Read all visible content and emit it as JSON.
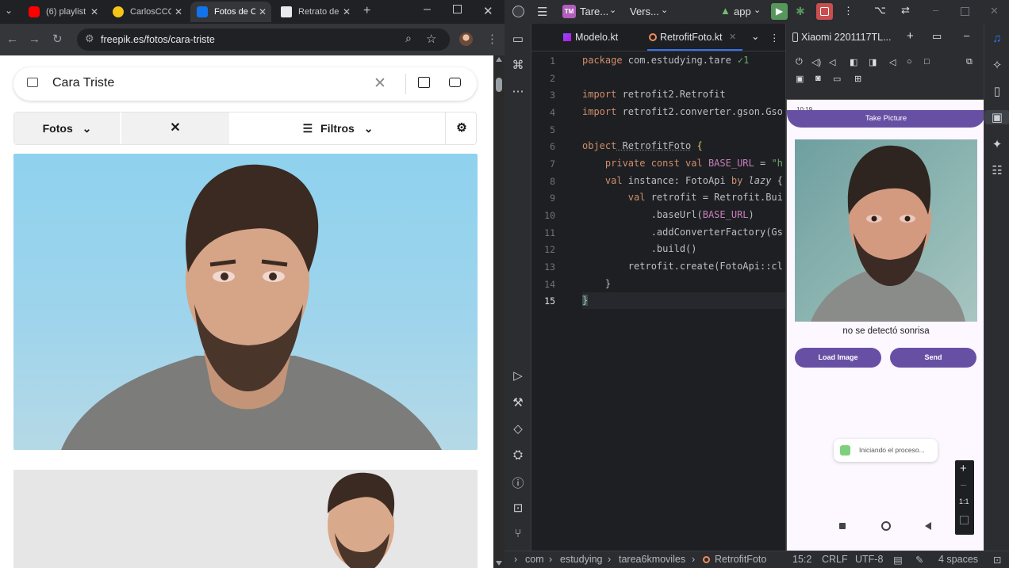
{
  "browser": {
    "tabs": [
      {
        "label": "(6) playlist",
        "favicon_color": "#ff0000"
      },
      {
        "label": "CarlosCCC",
        "favicon_color": "#f5c518"
      },
      {
        "label": "Fotos de C",
        "favicon_color": "#1273eb"
      },
      {
        "label": "Retrato de",
        "favicon_color": "#e8eaed"
      }
    ],
    "url": "freepik.es/fotos/cara-triste",
    "search": {
      "query": "Cara Triste"
    },
    "filters": {
      "photos_label": "Fotos",
      "filters_label": "Filtros"
    }
  },
  "ide": {
    "project": "Tare...",
    "project_badge": "TM",
    "vcs": "Vers...",
    "run_config": "app",
    "tabs": [
      {
        "label": "Modelo.kt"
      },
      {
        "label": "RetrofitFoto.kt"
      }
    ],
    "inspection": "1",
    "device": "Xiaomi 2201117TL...",
    "line_numbers": [
      "1",
      "2",
      "3",
      "4",
      "5",
      "6",
      "7",
      "8",
      "9",
      "10",
      "11",
      "12",
      "13",
      "14",
      "15"
    ],
    "code": {
      "l1_kw": "package",
      "l1_rest": " com.estudying.tare",
      "l3_kw": "import",
      "l3_rest": " retrofit2.Retrofit",
      "l4_kw": "import",
      "l4_rest": " retrofit2.converter.gson.Gso",
      "l6_kw": "object",
      "l6_name": " RetrofitFoto",
      "l6_brace": " {",
      "l7_kw": "    private const val",
      "l7_name": " BASE_URL",
      "l7_eq": " = ",
      "l7_str": "\"h",
      "l8_kw": "    val",
      "l8_rest": " instance: FotoApi ",
      "l8_by": "by",
      "l8_lazy": " lazy",
      "l8_brace": " {",
      "l9_kw": "        val",
      "l9_rest": " retrofit = Retrofit.Bui",
      "l10": "            .baseUrl(",
      "l10_c": "BASE_URL",
      "l10_end": ")",
      "l11": "            .addConverterFactory(Gs",
      "l12": "            .build()",
      "l13": "        retrofit.create(FotoApi::cl",
      "l14": "    }",
      "l15": "}"
    },
    "phone": {
      "time": "10:19",
      "title": "Take Picture",
      "result": "no se detectó sonrisa",
      "load_button": "Load Image",
      "send_button": "Send",
      "toast": "Iniciando el proceso...",
      "zoom_label": "1:1"
    },
    "breadcrumbs": [
      "com",
      "estudying",
      "tarea6kmoviles",
      "RetrofitFoto"
    ],
    "status": {
      "position": "15:2",
      "line_sep": "CRLF",
      "encoding": "UTF-8",
      "indent": "4 spaces"
    }
  }
}
